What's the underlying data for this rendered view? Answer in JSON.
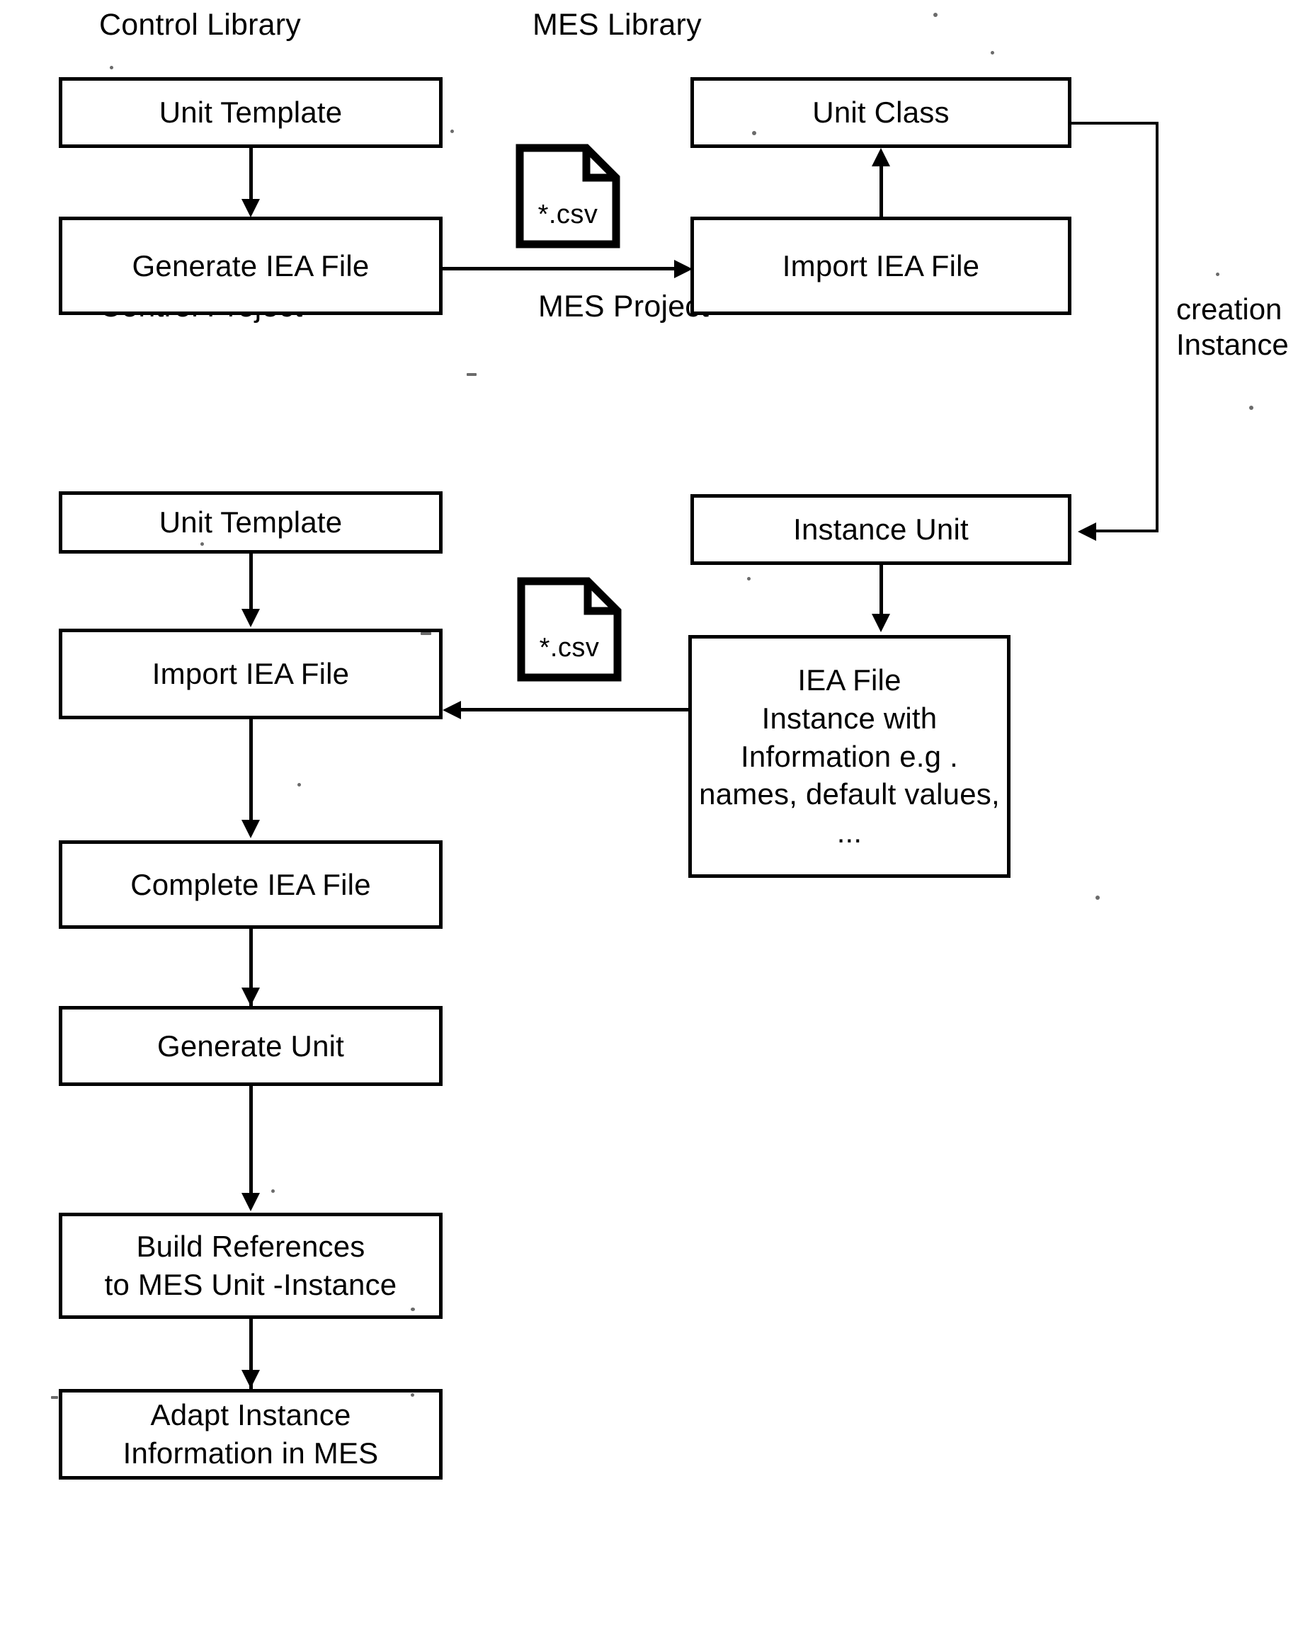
{
  "figure": {
    "type": "flow-diagram",
    "sections": [
      {
        "id": "control-library",
        "title": "Control Library"
      },
      {
        "id": "mes-library",
        "title": "MES  Library"
      },
      {
        "id": "control-project",
        "title": "Control Project"
      },
      {
        "id": "mes-project",
        "title": "MES Project"
      }
    ],
    "boxes": {
      "lib_unit_template": "Unit Template",
      "lib_generate_iea": "Generate IEA File",
      "mes_unit_class": "Unit Class",
      "mes_import_iea": "Import IEA File",
      "proj_unit_template": "Unit Template",
      "proj_import_iea": "Import IEA File",
      "proj_complete_iea": "Complete IEA File",
      "proj_generate_unit": "Generate Unit",
      "proj_build_references": "Build References\nto MES Unit -Instance",
      "proj_adapt_instance": "Adapt Instance\nInformation in MES",
      "mesproj_instance_unit": "Instance Unit",
      "mesproj_iea_file": "IEA File\nInstance with\nInformation e.g .\nnames, default values, ..."
    },
    "file_icons": {
      "csv_top": "*.csv",
      "csv_bottom": "*.csv"
    },
    "edge_labels": {
      "creation_instance": "creation\nInstance"
    },
    "colors": {
      "stroke": "#000000",
      "background": "#ffffff"
    }
  }
}
